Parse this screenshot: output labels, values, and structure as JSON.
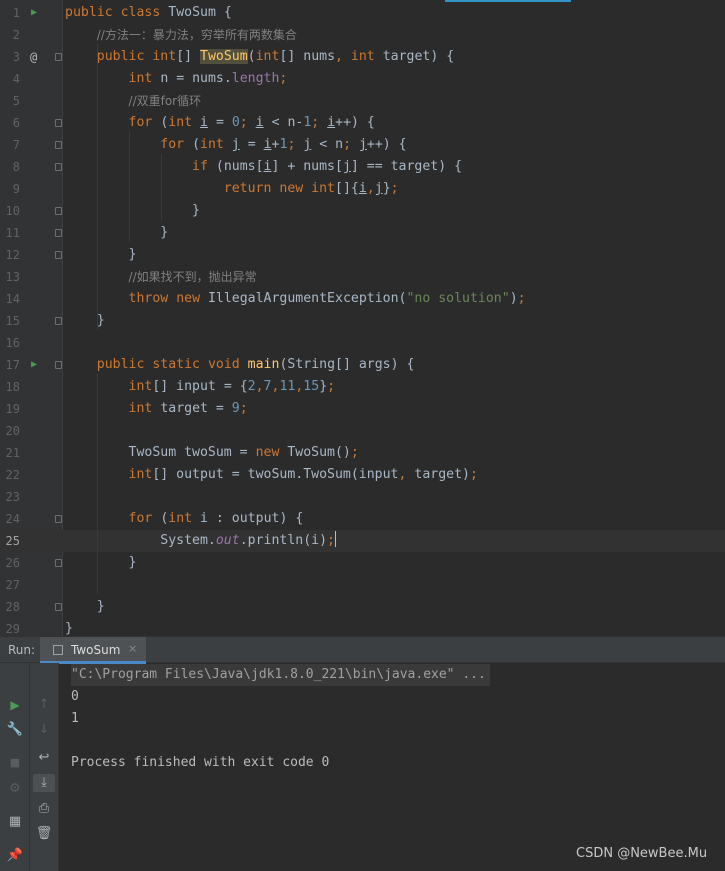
{
  "editor": {
    "current_line": 25,
    "line_numbers": [
      "1",
      "2",
      "3",
      "4",
      "5",
      "6",
      "7",
      "8",
      "9",
      "10",
      "11",
      "12",
      "13",
      "14",
      "15",
      "16",
      "17",
      "18",
      "19",
      "20",
      "21",
      "22",
      "23",
      "24",
      "25",
      "26",
      "27",
      "28",
      "29"
    ],
    "code": {
      "l1": [
        "public",
        "class",
        "TwoSum",
        "{"
      ],
      "l2": [
        "//方法一：暴力法，穷举所有两数集合"
      ],
      "l3": [
        "public",
        "int",
        "[] ",
        "TwoSum",
        "(",
        "int",
        "[] nums",
        ",",
        "int",
        "target) {"
      ],
      "l4": [
        "int",
        "n = nums.",
        "length",
        ";"
      ],
      "l5": [
        "//双重for循环"
      ],
      "l6": [
        "for",
        "(",
        "int",
        "i",
        " = ",
        "0",
        ";",
        "i",
        " < n-",
        "1",
        ";",
        "i",
        "++) {"
      ],
      "l7": [
        "for",
        "(",
        "int",
        "j",
        " = ",
        "i",
        "+",
        "1",
        ";",
        "j",
        " < n",
        ";",
        "j",
        "++) {"
      ],
      "l8": [
        "if",
        "(nums[",
        "i",
        "] + nums[",
        "j",
        "] == target) {"
      ],
      "l9": [
        "return",
        "new",
        "int",
        "[]{",
        "i",
        ",",
        "j",
        "}",
        ";"
      ],
      "l10": [
        "}"
      ],
      "l11": [
        "}"
      ],
      "l12": [
        "}"
      ],
      "l13": [
        "//如果找不到，抛出异常"
      ],
      "l14": [
        "throw",
        "new",
        "IllegalArgumentException(",
        "\"no solution\"",
        ")",
        ";"
      ],
      "l15": [
        "}"
      ],
      "l17": [
        "public",
        "static",
        "void",
        "main",
        "(String[] args) {"
      ],
      "l18": [
        "int",
        "[] input = {",
        "2",
        ",",
        "7",
        ",",
        "11",
        ",",
        "15",
        "}",
        ";"
      ],
      "l19": [
        "int",
        "target = ",
        "9",
        ";"
      ],
      "l21": [
        "TwoSum twoSum = ",
        "new",
        "TwoSum()",
        ";"
      ],
      "l22": [
        "int",
        "[] output = twoSum.TwoSum(input",
        ",",
        "target)",
        ";"
      ],
      "l24": [
        "for",
        "(",
        "int",
        "i : output) {"
      ],
      "l25": [
        "System.",
        "out",
        ".println(i)",
        ";"
      ],
      "l26": [
        "}"
      ],
      "l28": [
        "}"
      ],
      "l29": [
        "}"
      ]
    }
  },
  "run_panel": {
    "label": "Run:",
    "tab_label": "TwoSum",
    "close_glyph": "×",
    "console": {
      "command": "\"C:\\Program Files\\Java\\jdk1.8.0_221\\bin\\java.exe\" ...",
      "output": [
        "0",
        "1"
      ],
      "finish": "Process finished with exit code 0"
    }
  },
  "icons": {
    "run": "▶",
    "at": "@",
    "rerun": "▶",
    "wrench": "🔧",
    "stop": "■",
    "gear": "⚙",
    "layout": "▦",
    "pin": "📌",
    "up": "↑",
    "down": "↓",
    "wrap": "↩",
    "scroll": "⤓",
    "print": "⎙",
    "trash": "🗑"
  },
  "colors": {
    "keyword": "#cc7832",
    "number": "#6897bb",
    "string": "#6a8759",
    "comment": "#808080",
    "field": "#9876aa",
    "method": "#ffc66d",
    "run_green": "#499c54",
    "tab_accent": "#4a88c7"
  },
  "watermark": "CSDN @NewBee.Mu"
}
